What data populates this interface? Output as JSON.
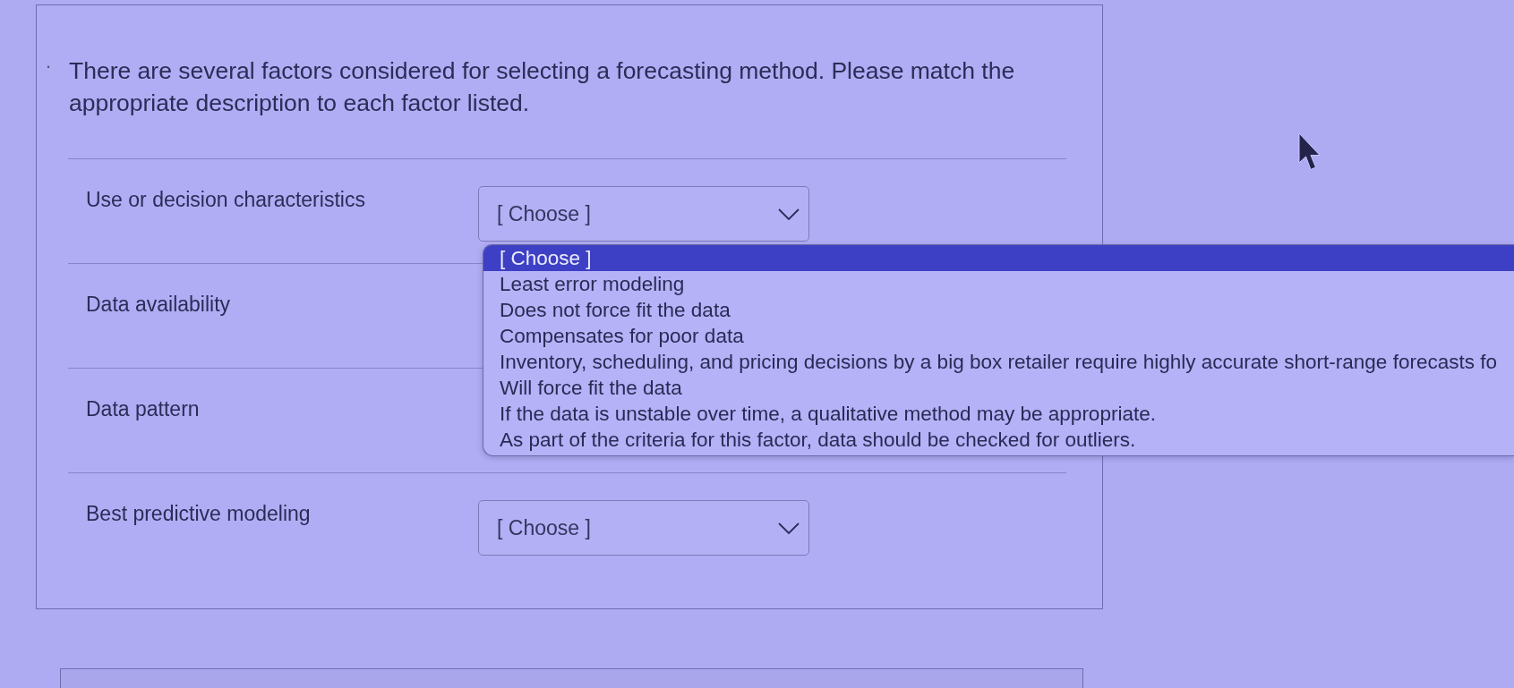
{
  "question": {
    "marker": ".",
    "text": "There are several factors considered for selecting a forecasting method. Please match the appropriate description to each factor listed."
  },
  "rows": [
    {
      "label": "Use or decision characteristics",
      "select": {
        "value": "[ Choose ]",
        "expanded": true,
        "options": [
          {
            "label": "[ Choose ]",
            "selected": true
          },
          {
            "label": "Least error modeling",
            "selected": false
          },
          {
            "label": "Does not force fit the data",
            "selected": false
          },
          {
            "label": "Compensates for poor data",
            "selected": false
          },
          {
            "label": "Inventory, scheduling, and pricing decisions by a big box retailer require highly accurate short-range forecasts fo",
            "selected": false
          },
          {
            "label": "Will force fit the data",
            "selected": false
          },
          {
            "label": "If the data is unstable over time, a qualitative method may be appropriate.",
            "selected": false
          },
          {
            "label": "As part of the criteria for this factor, data should be checked for outliers.",
            "selected": false
          }
        ]
      }
    },
    {
      "label": "Data availability"
    },
    {
      "label": "Data pattern"
    },
    {
      "label": "Best predictive modeling",
      "select": {
        "value": "[ Choose ]"
      }
    }
  ]
}
